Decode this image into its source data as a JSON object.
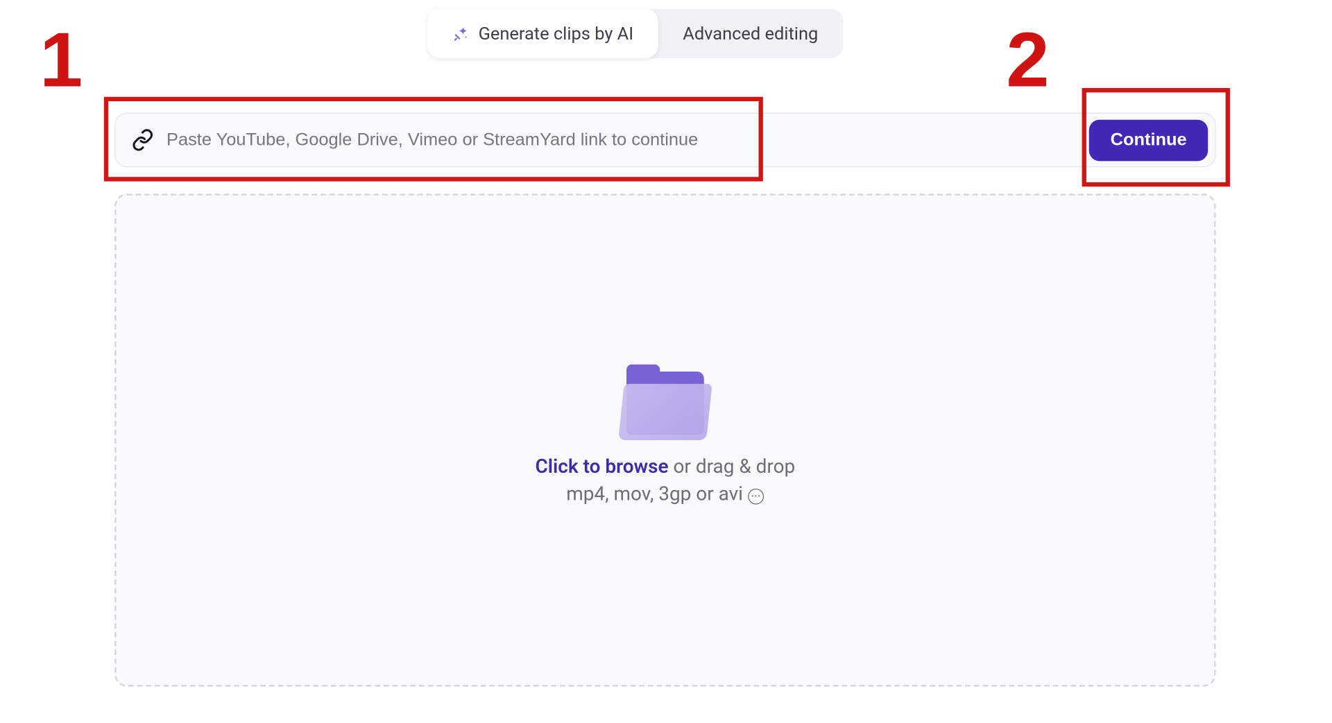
{
  "tabs": {
    "generate": "Generate clips by AI",
    "advanced": "Advanced editing"
  },
  "input": {
    "placeholder": "Paste YouTube, Google Drive, Vimeo or StreamYard link to continue",
    "continue": "Continue"
  },
  "dropzone": {
    "browse": "Click to browse",
    "rest": " or drag & drop",
    "formats": "mp4, mov, 3gp or avi"
  },
  "annotations": {
    "one": "1",
    "two": "2"
  },
  "colors": {
    "accent": "#4328b6",
    "annotation": "#d01515"
  }
}
